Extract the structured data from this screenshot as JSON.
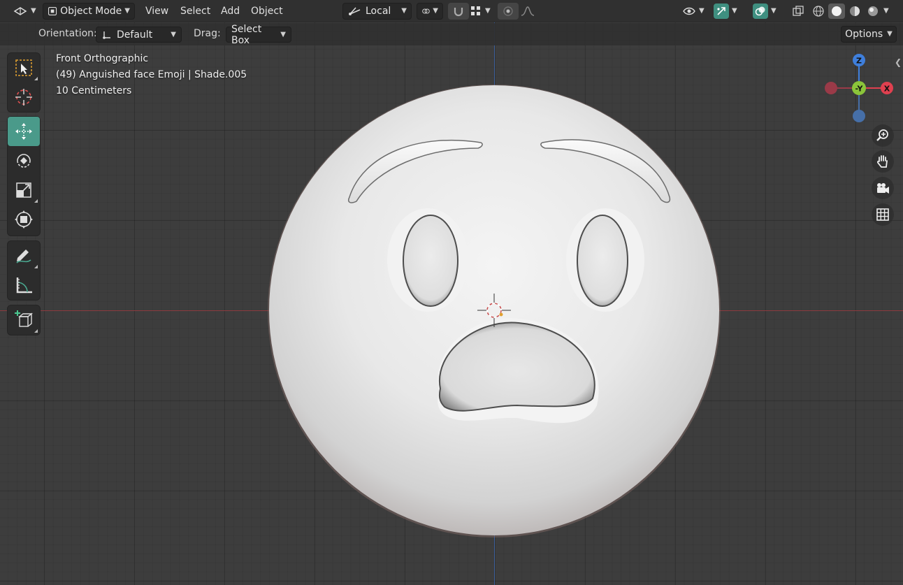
{
  "header": {
    "editor_type_icon": "editor-type-icon",
    "mode_label": "Object Mode",
    "menus": [
      "View",
      "Select",
      "Add",
      "Object"
    ],
    "transform_orientation": "Local"
  },
  "tool_settings": {
    "orientation_label": "Orientation:",
    "orientation_value": "Default",
    "drag_label": "Drag:",
    "drag_value": "Select Box",
    "options_label": "Options"
  },
  "viewport_overlay": {
    "view_name": "Front Orthographic",
    "object_info": "(49) Anguished face Emoji | Shade.005",
    "grid_scale": "10 Centimeters"
  },
  "gizmo": {
    "z_label": "Z",
    "y_label": "-Y",
    "x_label": "X",
    "colors": {
      "x": "#e0404f",
      "y": "#8bc43a",
      "z": "#3f7fdc",
      "neg_x": "#9a3a48",
      "neg_z": "#466fa8"
    }
  },
  "colors": {
    "accent_active_tool": "#4a9a8a",
    "x_axis_line": "#8b3a3f",
    "z_axis_line": "#3c5f9a",
    "viewport_bg": "#3d3d3d"
  },
  "tools": [
    "select-box-tool",
    "cursor-tool",
    "move-tool",
    "rotate-tool",
    "scale-tool",
    "transform-tool",
    "annotate-tool",
    "measure-tool",
    "add-cube-tool"
  ],
  "nav_buttons": [
    "zoom-icon",
    "pan-hand-icon",
    "camera-icon",
    "ortho-grid-icon"
  ]
}
